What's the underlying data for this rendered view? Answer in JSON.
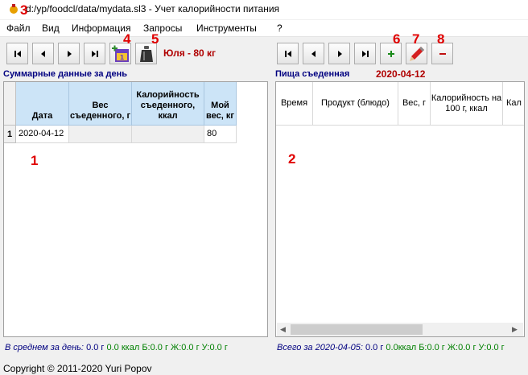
{
  "window": {
    "title": "d:/yp/foodcl/data/mydata.sl3 - Учет калорийности питания"
  },
  "menu": [
    "Файл",
    "Вид",
    "Информация",
    "Запросы",
    "Инструменты",
    "?"
  ],
  "user_label": "Юля - 80 кг",
  "markers": [
    "1",
    "2",
    "3",
    "4",
    "5",
    "6",
    "7",
    "8"
  ],
  "left_panel": {
    "title": "Суммарные данные за день",
    "columns": [
      "Дата",
      "Вес съеденного, г",
      "Калорийность съеденного, ккал",
      "Мой вес, кг"
    ],
    "rows": [
      {
        "num": "1",
        "date": "2020-04-12",
        "weight": "",
        "calories": "",
        "my_weight": "80"
      }
    ]
  },
  "right_panel": {
    "title": "Пища съеденная",
    "date": "2020-04-12",
    "columns": [
      "Время",
      "Продукт (блюдо)",
      "Вес, г",
      "Калорийность на 100 г, ккал",
      "Кал"
    ]
  },
  "status_left": {
    "prefix": "В среднем за день:",
    "weight": "0.0 г",
    "kcal": "0.0 ккал",
    "b": "Б:0.0 г",
    "zh": "Ж:0.0 г",
    "u": "У:0.0 г"
  },
  "status_right": {
    "prefix": "Всего за 2020-04-05:",
    "weight": "0.0 г",
    "kcal": "0.0ккал",
    "b": "Б:0.0 г",
    "zh": "Ж:0.0 г",
    "u": "У:0.0 г"
  },
  "copyright": "Copyright © 2011-2020 Yuri Popov",
  "colors": {
    "accent_red": "#b00000",
    "header_blue": "#cce4f7",
    "status_navy": "#000080",
    "status_green": "#008000"
  }
}
